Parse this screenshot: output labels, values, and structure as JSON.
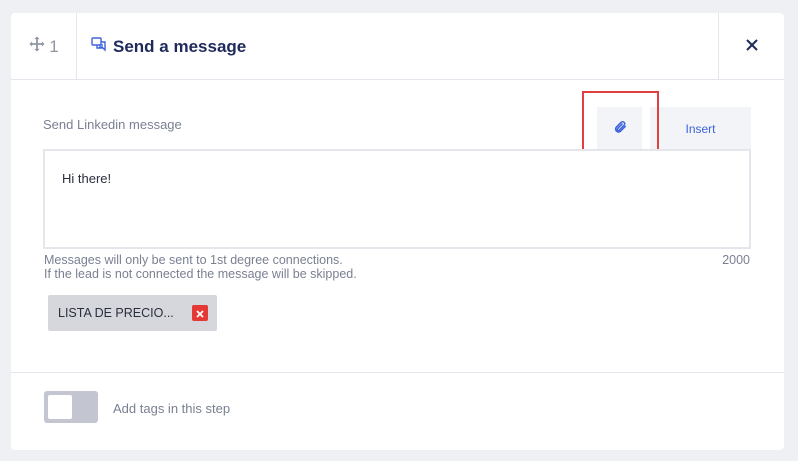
{
  "header": {
    "step_number": "1",
    "title": "Send a message"
  },
  "message": {
    "label": "Send Linkedin message",
    "insert_label": "Insert",
    "value": "Hi there!",
    "hint_line1": "Messages will only be sent to 1st degree connections.",
    "hint_line2": "If the lead is not connected the message will be skipped.",
    "char_count": "2000"
  },
  "attachment": {
    "name": "LISTA DE PRECIO..."
  },
  "tags": {
    "label": "Add tags in this step",
    "enabled": false
  },
  "colors": {
    "accent": "#3d63dd",
    "title": "#1f2a5c",
    "remove": "#e53935",
    "highlight": "#e0403f"
  }
}
